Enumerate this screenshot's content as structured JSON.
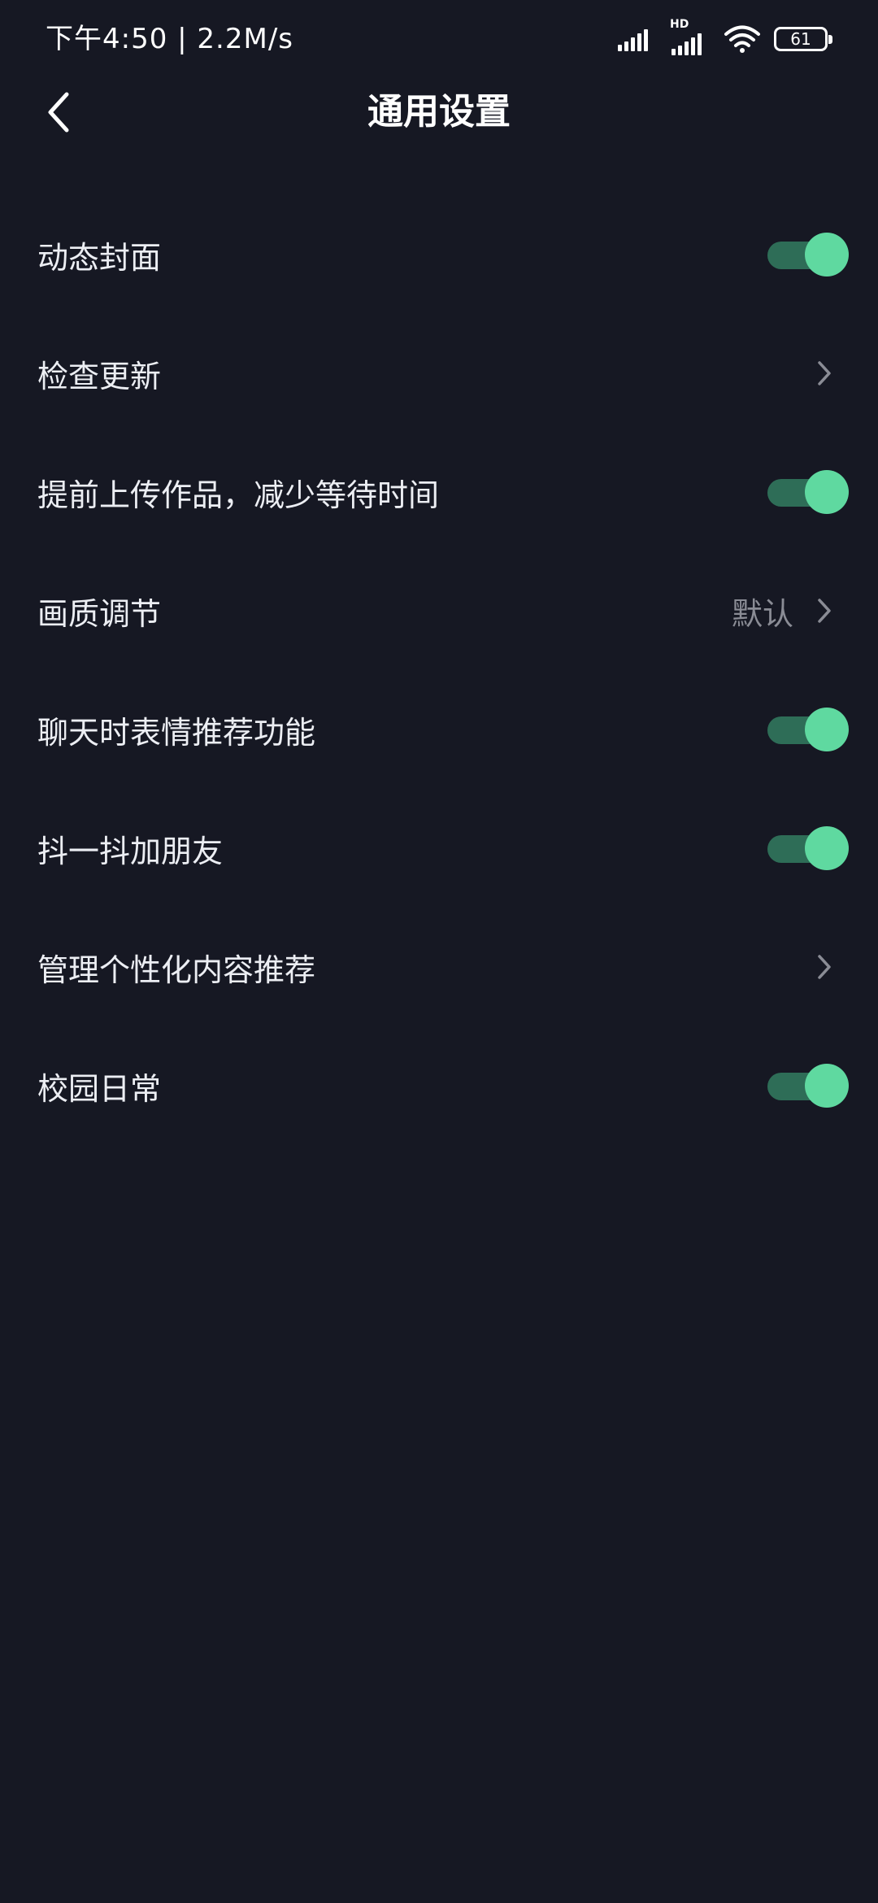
{
  "status_bar": {
    "time": "下午4:50 | 2.2M/s",
    "network_badge": "HD",
    "battery": "61"
  },
  "header": {
    "title": "通用设置",
    "back_icon": "chevron-left-icon"
  },
  "settings": [
    {
      "label": "动态封面",
      "control": "toggle",
      "on": true
    },
    {
      "label": "检查更新",
      "control": "chevron"
    },
    {
      "label": "提前上传作品，减少等待时间",
      "control": "toggle",
      "on": true
    },
    {
      "label": "画质调节",
      "control": "chevron",
      "value": "默认"
    },
    {
      "label": "聊天时表情推荐功能",
      "control": "toggle",
      "on": true
    },
    {
      "label": "抖一抖加朋友",
      "control": "toggle",
      "on": true
    },
    {
      "label": "管理个性化内容推荐",
      "control": "chevron"
    },
    {
      "label": "校园日常",
      "control": "toggle",
      "on": true
    }
  ],
  "colors": {
    "background": "#161823",
    "toggle_track": "#2e6d57",
    "toggle_knob": "#5fd9a0",
    "secondary_text": "#8a8c95"
  }
}
